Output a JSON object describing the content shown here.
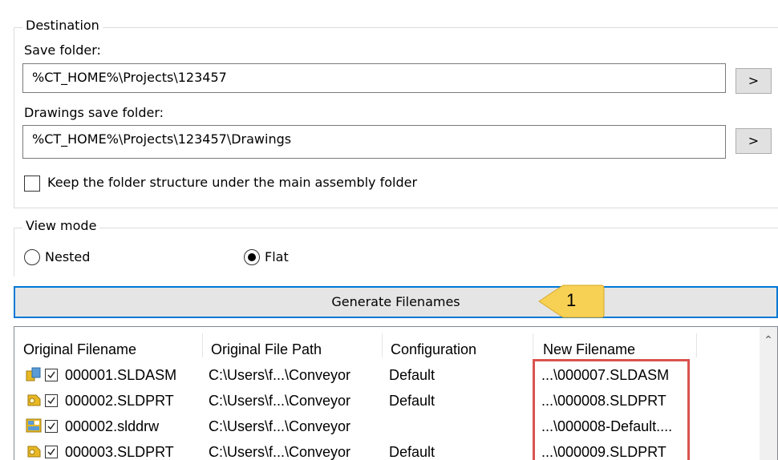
{
  "destination": {
    "title": "Destination",
    "save_folder_label": "Save folder:",
    "save_folder_value": "%CT_HOME%\\Projects\\123457",
    "drawings_folder_label": "Drawings save folder:",
    "drawings_folder_value": "%CT_HOME%\\Projects\\123457\\Drawings",
    "browse_label": ">",
    "keep_structure_label": "Keep the folder structure under the main assembly folder",
    "keep_structure_checked": false
  },
  "view_mode": {
    "title": "View mode",
    "options": [
      {
        "label": "Nested",
        "selected": false
      },
      {
        "label": "Flat",
        "selected": true
      }
    ]
  },
  "generate_button": {
    "label": "Generate Filenames"
  },
  "callout": {
    "number": "1",
    "color": "#f7d154"
  },
  "file_list": {
    "columns": [
      "Original Filename",
      "Original File Path",
      "Configuration",
      "New Filename"
    ],
    "rows": [
      {
        "icon": "assembly-icon",
        "checked": true,
        "filename": "000001.SLDASM",
        "path": "C:\\Users\\f...\\Conveyor",
        "configuration": "Default",
        "new_filename": "...\\000007.SLDASM"
      },
      {
        "icon": "part-icon",
        "checked": true,
        "filename": "000002.SLDPRT",
        "path": "C:\\Users\\f...\\Conveyor",
        "configuration": "Default",
        "new_filename": "...\\000008.SLDPRT"
      },
      {
        "icon": "drawing-icon",
        "checked": true,
        "filename": "000002.slddrw",
        "path": "C:\\Users\\f...\\Conveyor",
        "configuration": "",
        "new_filename": "...\\000008-Default...."
      },
      {
        "icon": "part-icon",
        "checked": true,
        "filename": "000003.SLDPRT",
        "path": "C:\\Users\\f...\\Conveyor",
        "configuration": "Default",
        "new_filename": "...\\000009.SLDPRT"
      }
    ],
    "highlight_color": "#d9534f"
  }
}
